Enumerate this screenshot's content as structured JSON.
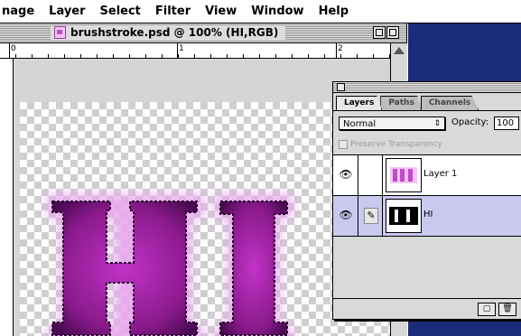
{
  "menubar": {
    "items": [
      "nage",
      "Layer",
      "Select",
      "Filter",
      "View",
      "Window",
      "Help"
    ]
  },
  "document": {
    "title": "brushstroke.psd @ 100% (HI,RGB)",
    "ruler_labels": [
      "0",
      "1",
      "2"
    ]
  },
  "layers_palette": {
    "tabs": [
      "Layers",
      "Paths",
      "Channels"
    ],
    "active_tab": "Layers",
    "blend_mode": "Normal",
    "opacity_label": "Opacity:",
    "opacity_value": "100",
    "preserve_transparency_label": "Preserve Transparency",
    "layers": [
      {
        "name": "Layer 1",
        "visible": true,
        "selected": false
      },
      {
        "name": "HI",
        "visible": true,
        "selected": true
      }
    ]
  },
  "icons": {
    "eye": "eye-icon",
    "brush": "brush-icon",
    "new_layer": "new-layer-icon",
    "trash": "trash-icon"
  },
  "colors": {
    "desktop_blue": "#1b2d7a",
    "letter_purple": "#8a1a8c",
    "glow": "#e9a6ee",
    "selected_row": "#c9c9f0"
  }
}
